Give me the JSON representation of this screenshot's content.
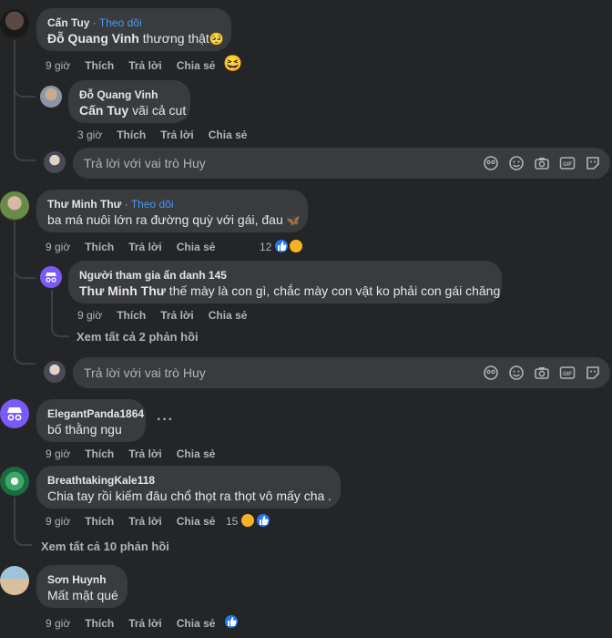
{
  "reply_placeholder": "Trả lời với vai trò Huy",
  "actions": {
    "like": "Thích",
    "reply": "Trả lời",
    "share": "Chia sẻ"
  },
  "follow_label": "Theo dõi",
  "comments": [
    {
      "author": "Cấn Tuy",
      "follow": true,
      "mention": "Đỗ Quang Vinh",
      "text": " thương thật",
      "emoji": "🥺",
      "time": "9 giờ",
      "reaction_emoji": "😆",
      "replies": [
        {
          "author": "Đỗ Quang Vinh",
          "mention": "Cấn Tuy",
          "text": " vãi cả cut",
          "time": "3 giờ"
        }
      ]
    },
    {
      "author": "Thư Minh Thư",
      "follow": true,
      "text": "ba má nuôi lớn ra đường quỳ với gái, đau ",
      "emoji": "🦋",
      "time": "9 giờ",
      "reaction_count": "12",
      "replies": [
        {
          "author": "Người tham gia ẩn danh 145",
          "mention": "Thư Minh Thư",
          "text": " thế mày là con gì, chắc mày con vật ko phải con gái chăng",
          "time": "9 giờ"
        }
      ],
      "see_more": "Xem tất cả 2 phản hồi"
    },
    {
      "author": "ElegantPanda1864",
      "text": "bố thằng ngu",
      "time": "9 giờ",
      "more": "···"
    },
    {
      "author": "BreathtakingKale118",
      "text": "Chia tay rồi kiếm đâu chổ thọt ra thọt vô mấy cha .",
      "time": "9 giờ",
      "reaction_count": "15",
      "see_more": "Xem tất cả 10 phản hồi"
    },
    {
      "author": "Sơn Huynh",
      "text": "Mất mặt qué",
      "time": "9 giờ"
    }
  ],
  "colors": {
    "background": "#242526",
    "bubble": "#3a3b3c",
    "link": "#4599ff",
    "muted": "#b0b3b8"
  }
}
